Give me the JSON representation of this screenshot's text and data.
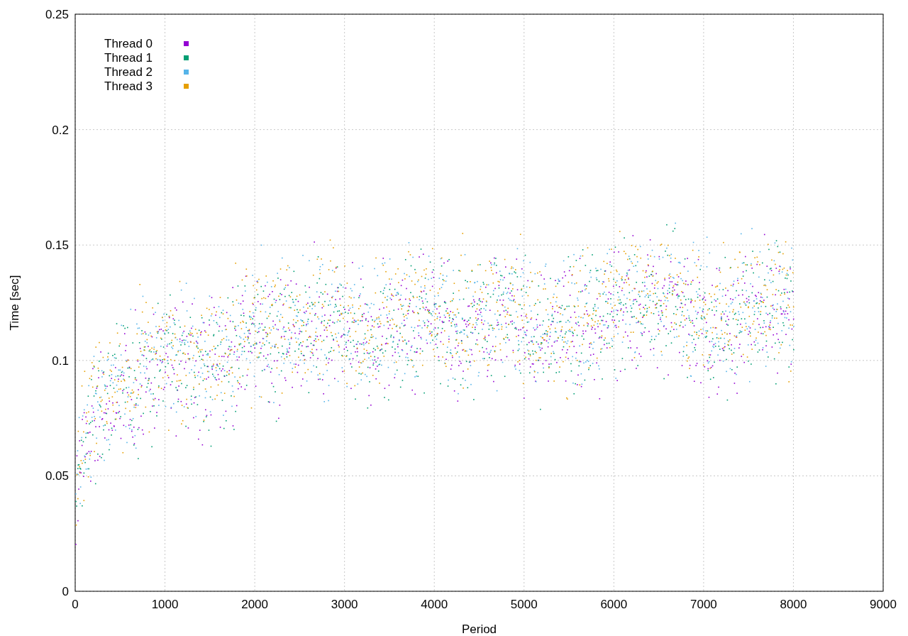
{
  "plot": {
    "y_axis_title": "Time [sec]",
    "x_axis_title": "Period",
    "x_tick_labels": [
      "0",
      "1000",
      "2000",
      "3000",
      "4000",
      "5000",
      "6000",
      "7000",
      "8000",
      "9000"
    ],
    "y_tick_labels": [
      "0.25",
      "0.2",
      "0.15",
      "0.1",
      "0.05",
      "0"
    ],
    "legend": [
      {
        "label": "Thread 0",
        "color": "#9400d3"
      },
      {
        "label": "Thread 1",
        "color": "#009e73"
      },
      {
        "label": "Thread 2",
        "color": "#56b4e9"
      },
      {
        "label": "Thread 3",
        "color": "#e69f00"
      }
    ]
  }
}
